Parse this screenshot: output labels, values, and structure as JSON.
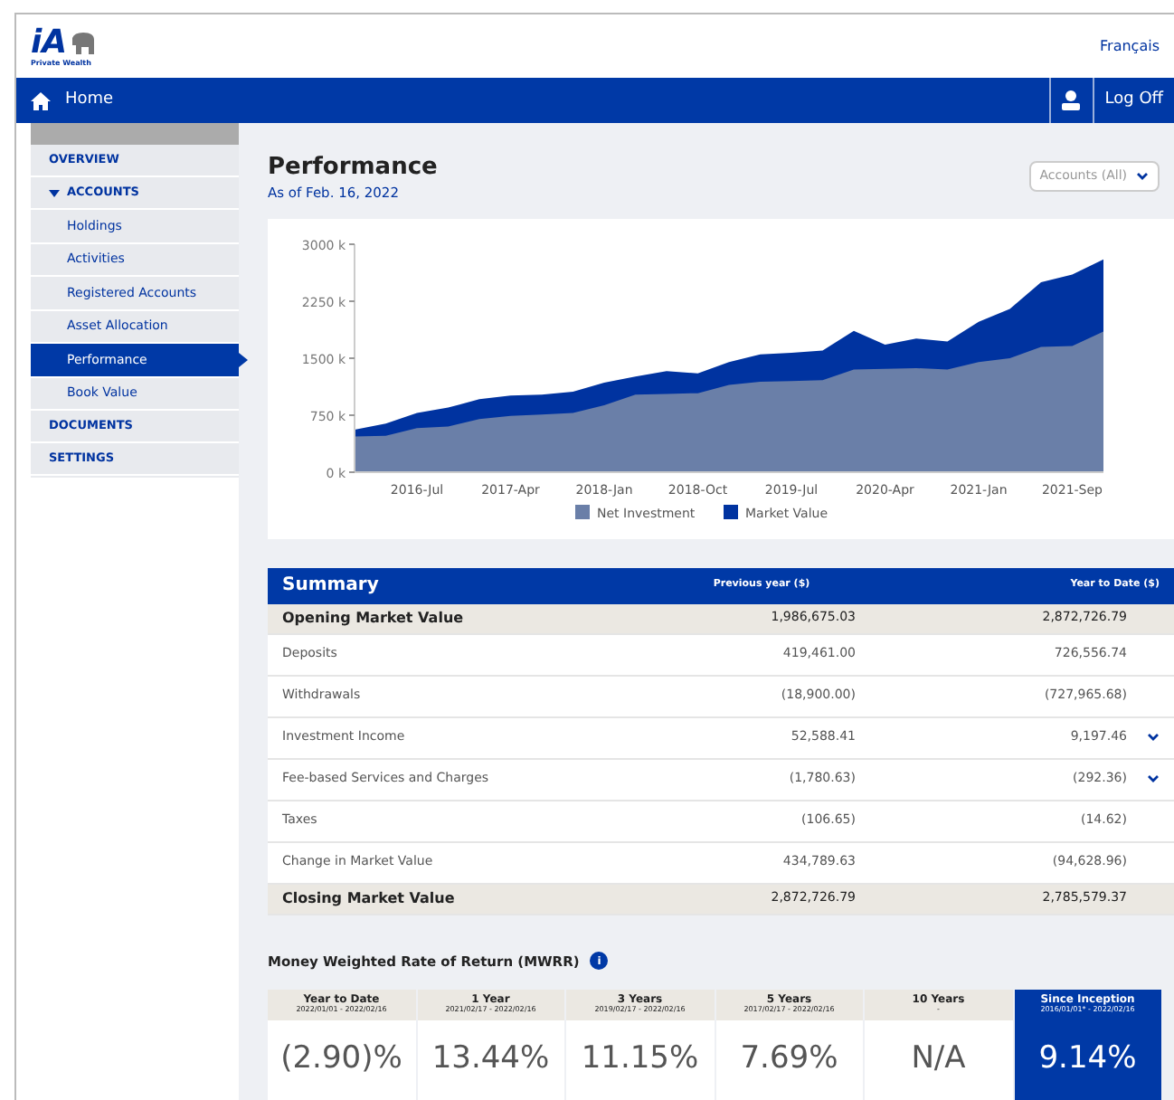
{
  "header": {
    "logo_text": "iA",
    "logo_subtext": "Private Wealth",
    "language_link": "Français"
  },
  "nav": {
    "home": "Home",
    "logoff": "Log Off"
  },
  "sidebar": {
    "items": [
      {
        "label": "OVERVIEW",
        "selected": false,
        "expanded": false
      },
      {
        "label": "ACCOUNTS",
        "selected": false,
        "expanded": true,
        "children": [
          {
            "label": "Holdings",
            "selected": false
          },
          {
            "label": "Activities",
            "selected": false
          },
          {
            "label": "Registered Accounts",
            "selected": false
          },
          {
            "label": "Asset Allocation",
            "selected": false
          },
          {
            "label": "Performance",
            "selected": true
          },
          {
            "label": "Book Value",
            "selected": false
          }
        ]
      },
      {
        "label": "DOCUMENTS",
        "selected": false,
        "expanded": false
      },
      {
        "label": "SETTINGS",
        "selected": false,
        "expanded": false
      }
    ]
  },
  "page": {
    "title": "Performance",
    "subtitle": "As of Feb. 16, 2022",
    "account_select": "Accounts (All)"
  },
  "chart_data": {
    "type": "area",
    "categories": [
      null,
      null,
      "2016-Jul",
      null,
      null,
      "2017-Apr",
      null,
      null,
      "2018-Jan",
      null,
      null,
      "2018-Oct",
      null,
      null,
      "2019-Jul",
      null,
      null,
      "2020-Apr",
      null,
      null,
      "2021-Jan",
      null,
      null,
      "2021-Sep",
      null
    ],
    "legend": "bottom",
    "series": [
      {
        "name": "Net Investment",
        "color": "#6a7fa8",
        "values": [
          470,
          480,
          580,
          600,
          700,
          740,
          760,
          780,
          880,
          1020,
          1030,
          1040,
          1150,
          1190,
          1200,
          1210,
          1350,
          1360,
          1370,
          1350,
          1450,
          1500,
          1650,
          1660,
          1850
        ]
      },
      {
        "name": "Market Value",
        "color": "#0033a0",
        "values": [
          560,
          640,
          780,
          850,
          960,
          1010,
          1020,
          1060,
          1180,
          1260,
          1330,
          1300,
          1450,
          1550,
          1570,
          1600,
          1860,
          1680,
          1760,
          1720,
          1980,
          2150,
          2500,
          2600,
          2800
        ]
      }
    ],
    "ylim": [
      0,
      3000
    ],
    "yticks": [
      {
        "value": 0,
        "label": "0 k"
      },
      {
        "value": 750,
        "label": "750 k"
      },
      {
        "value": 1500,
        "label": "1500 k"
      },
      {
        "value": 2250,
        "label": "2250 k"
      },
      {
        "value": 3000,
        "label": "3000 k"
      }
    ]
  },
  "summary": {
    "title": "Summary",
    "columns": [
      "Previous year ($)",
      "Year to Date ($)"
    ],
    "rows": [
      {
        "kind": "total",
        "label": "Opening Market Value",
        "previous": "1,986,675.03",
        "ytd": "2,872,726.79",
        "expandable": false
      },
      {
        "kind": "line",
        "label": "Deposits",
        "previous": "419,461.00",
        "ytd": "726,556.74",
        "expandable": false
      },
      {
        "kind": "line",
        "label": "Withdrawals",
        "previous": "(18,900.00)",
        "ytd": "(727,965.68)",
        "expandable": false
      },
      {
        "kind": "line",
        "label": "Investment Income",
        "previous": "52,588.41",
        "ytd": "9,197.46",
        "expandable": true
      },
      {
        "kind": "line",
        "label": "Fee-based Services and Charges",
        "previous": "(1,780.63)",
        "ytd": "(292.36)",
        "expandable": true
      },
      {
        "kind": "line",
        "label": "Taxes",
        "previous": "(106.65)",
        "ytd": "(14.62)",
        "expandable": false
      },
      {
        "kind": "line",
        "label": "Change in Market Value",
        "previous": "434,789.63",
        "ytd": "(94,628.96)",
        "expandable": false
      },
      {
        "kind": "total",
        "label": "Closing Market Value",
        "previous": "2,872,726.79",
        "ytd": "2,785,579.37",
        "expandable": false
      }
    ]
  },
  "mwrr": {
    "title": "Money Weighted Rate of Return (MWRR)",
    "info_icon": "i",
    "periods": [
      {
        "label": "Year to Date",
        "range": "2022/01/01 - 2022/02/16",
        "value": "(2.90)%",
        "selected": false
      },
      {
        "label": "1 Year",
        "range": "2021/02/17 - 2022/02/16",
        "value": "13.44%",
        "selected": false
      },
      {
        "label": "3 Years",
        "range": "2019/02/17 - 2022/02/16",
        "value": "11.15%",
        "selected": false
      },
      {
        "label": "5 Years",
        "range": "2017/02/17 - 2022/02/16",
        "value": "7.69%",
        "selected": false
      },
      {
        "label": "10 Years",
        "range": "-",
        "value": "N/A",
        "selected": false
      },
      {
        "label": "Since Inception",
        "range": "2016/01/01* - 2022/02/16",
        "value": "9.14%",
        "selected": true
      }
    ]
  }
}
